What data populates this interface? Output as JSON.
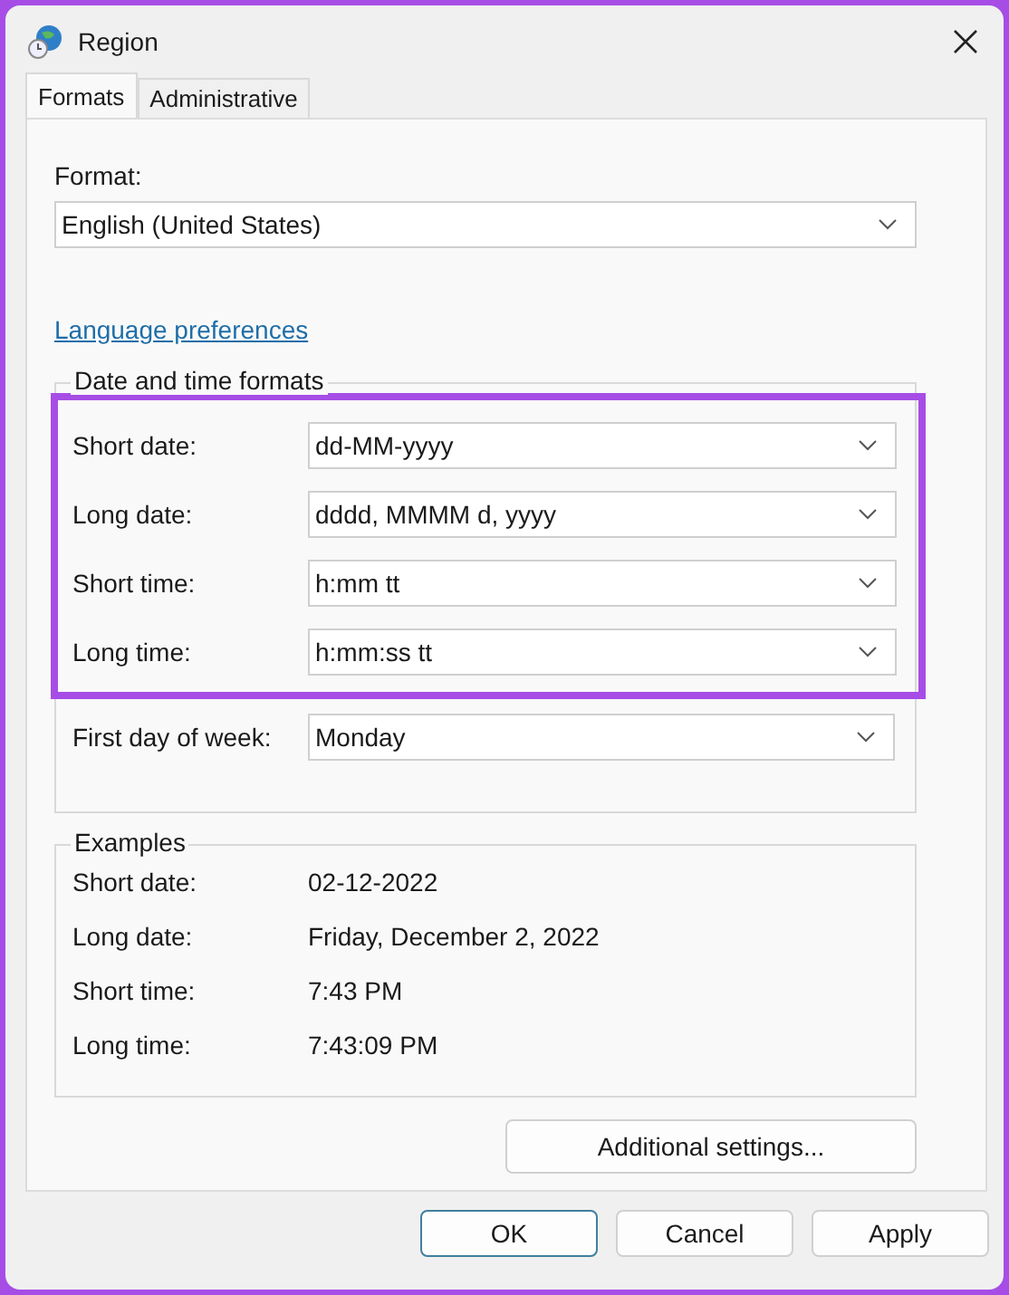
{
  "window": {
    "title": "Region"
  },
  "tabs": [
    {
      "label": "Formats",
      "selected": true
    },
    {
      "label": "Administrative",
      "selected": false
    }
  ],
  "format": {
    "label": "Format:",
    "value": "English (United States)"
  },
  "language_link": "Language preferences",
  "date_time_formats": {
    "title": "Date and time formats",
    "highlighted_rows": [
      {
        "label": "Short date:",
        "value": "dd-MM-yyyy"
      },
      {
        "label": "Long date:",
        "value": "dddd, MMMM d, yyyy"
      },
      {
        "label": "Short time:",
        "value": "h:mm tt"
      },
      {
        "label": "Long time:",
        "value": "h:mm:ss tt"
      }
    ],
    "rows": [
      {
        "label": "First day of week:",
        "value": "Monday"
      }
    ]
  },
  "examples": {
    "title": "Examples",
    "rows": [
      {
        "label": "Short date:",
        "value": "02-12-2022"
      },
      {
        "label": "Long date:",
        "value": "Friday, December 2, 2022"
      },
      {
        "label": "Short time:",
        "value": "7:43 PM"
      },
      {
        "label": "Long time:",
        "value": "7:43:09 PM"
      }
    ]
  },
  "additional_button": "Additional settings...",
  "buttons": [
    {
      "label": "OK",
      "default": true
    },
    {
      "label": "Cancel",
      "default": false
    },
    {
      "label": "Apply",
      "default": false
    }
  ]
}
